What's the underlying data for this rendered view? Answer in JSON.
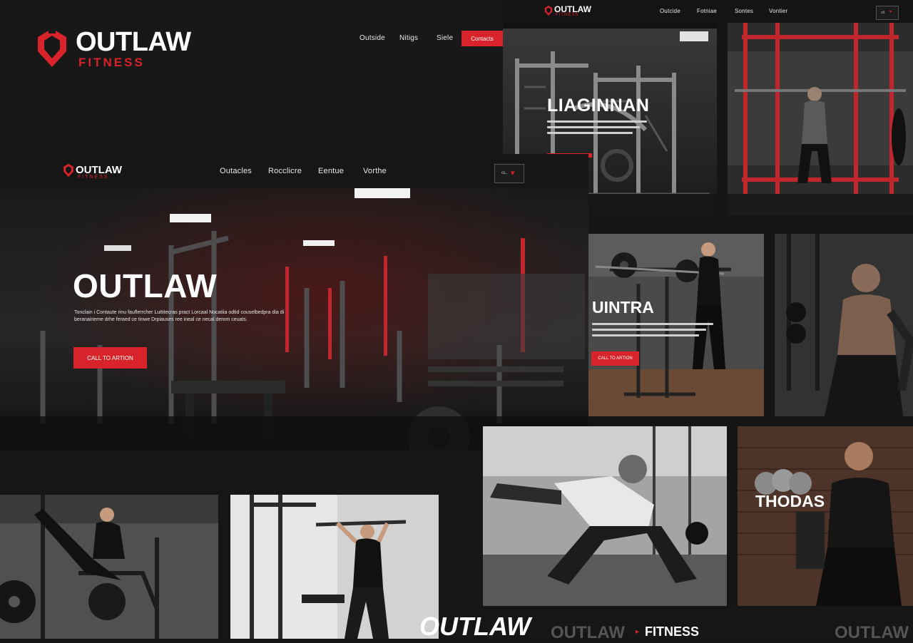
{
  "top_header": {
    "logo_word": "OUTLAW",
    "logo_sub": "FITNESS",
    "nav": [
      "Outside",
      "Nitigs",
      "Siele"
    ],
    "cta": "Contacts"
  },
  "top_right_header": {
    "logo_word": "OUTLAW",
    "logo_sub": "FITNESS",
    "nav": [
      "Outcide",
      "Fotniae",
      "Sontes",
      "Vontier"
    ],
    "select_label": "ctl."
  },
  "hero_header": {
    "logo_word": "OUTLAW",
    "logo_sub": "FITNESS",
    "nav": [
      "Outacles",
      "Rocclicre",
      "Eentue",
      "Vorthe"
    ],
    "select_label": "oL."
  },
  "hero": {
    "title": "OUTLAW",
    "body": "Tonclain i Contaute rinu fauflerrcher Luttitecras pract Lorcaal Nocatiia odtid couselbedpra dia di beranairieme drhe feraed ce tinwe Drpiauses ree ineal ce necal derom ceuats.",
    "cta": "CALL TO ARTION"
  },
  "card_liaginnan": {
    "title": "LIAGINNAN"
  },
  "card_uintra": {
    "title": "UINTRA",
    "cta": "CALL TO ARTION"
  },
  "card_thodas": {
    "title": "THODAS"
  },
  "footer": {
    "word1": "OUTLAW",
    "word2": "OUTLAW",
    "word3": "FITNESS",
    "word4": "OUTLAW"
  },
  "colors": {
    "accent": "#d8232a",
    "bg": "#151515",
    "panel": "#1c1c1c"
  }
}
